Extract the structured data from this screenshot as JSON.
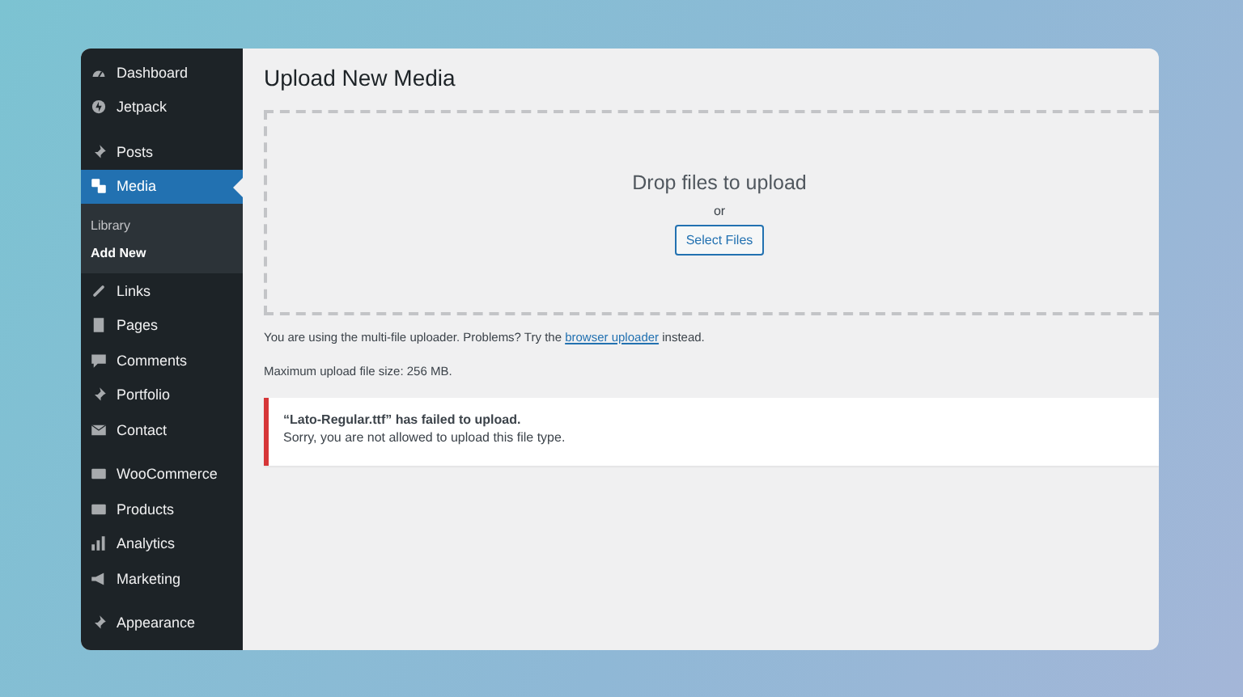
{
  "sidebar": {
    "groups": [
      {
        "items": [
          {
            "label": "Dashboard",
            "selected": false
          },
          {
            "label": "Jetpack",
            "selected": false
          }
        ]
      },
      {
        "items": [
          {
            "label": "Posts",
            "selected": false
          },
          {
            "label": "Media",
            "selected": true,
            "children": [
              {
                "label": "Library",
                "selected": false
              },
              {
                "label": "Add New",
                "selected": true
              }
            ]
          },
          {
            "label": "Links",
            "selected": false
          },
          {
            "label": "Pages",
            "selected": false
          },
          {
            "label": "Comments",
            "selected": false
          },
          {
            "label": "Portfolio",
            "selected": false
          },
          {
            "label": "Contact",
            "selected": false
          }
        ]
      },
      {
        "items": [
          {
            "label": "WooCommerce",
            "selected": false
          },
          {
            "label": "Products",
            "selected": false
          },
          {
            "label": "Analytics",
            "selected": false
          },
          {
            "label": "Marketing",
            "selected": false
          }
        ]
      },
      {
        "items": [
          {
            "label": "Appearance",
            "selected": false
          }
        ]
      }
    ]
  },
  "page": {
    "title": "Upload New Media",
    "dropzone": {
      "heading": "Drop files to upload",
      "or": "or",
      "button": "Select Files"
    },
    "uploader_note": {
      "before": "You are using the multi-file uploader. Problems? Try the",
      "link": "browser uploader",
      "after": "instead."
    },
    "max_size": "Maximum upload file size: 256 MB.",
    "error": {
      "title": "“Lato-Regular.ttf” has failed to upload.",
      "message": "Sorry, you are not allowed to upload this file type."
    }
  }
}
